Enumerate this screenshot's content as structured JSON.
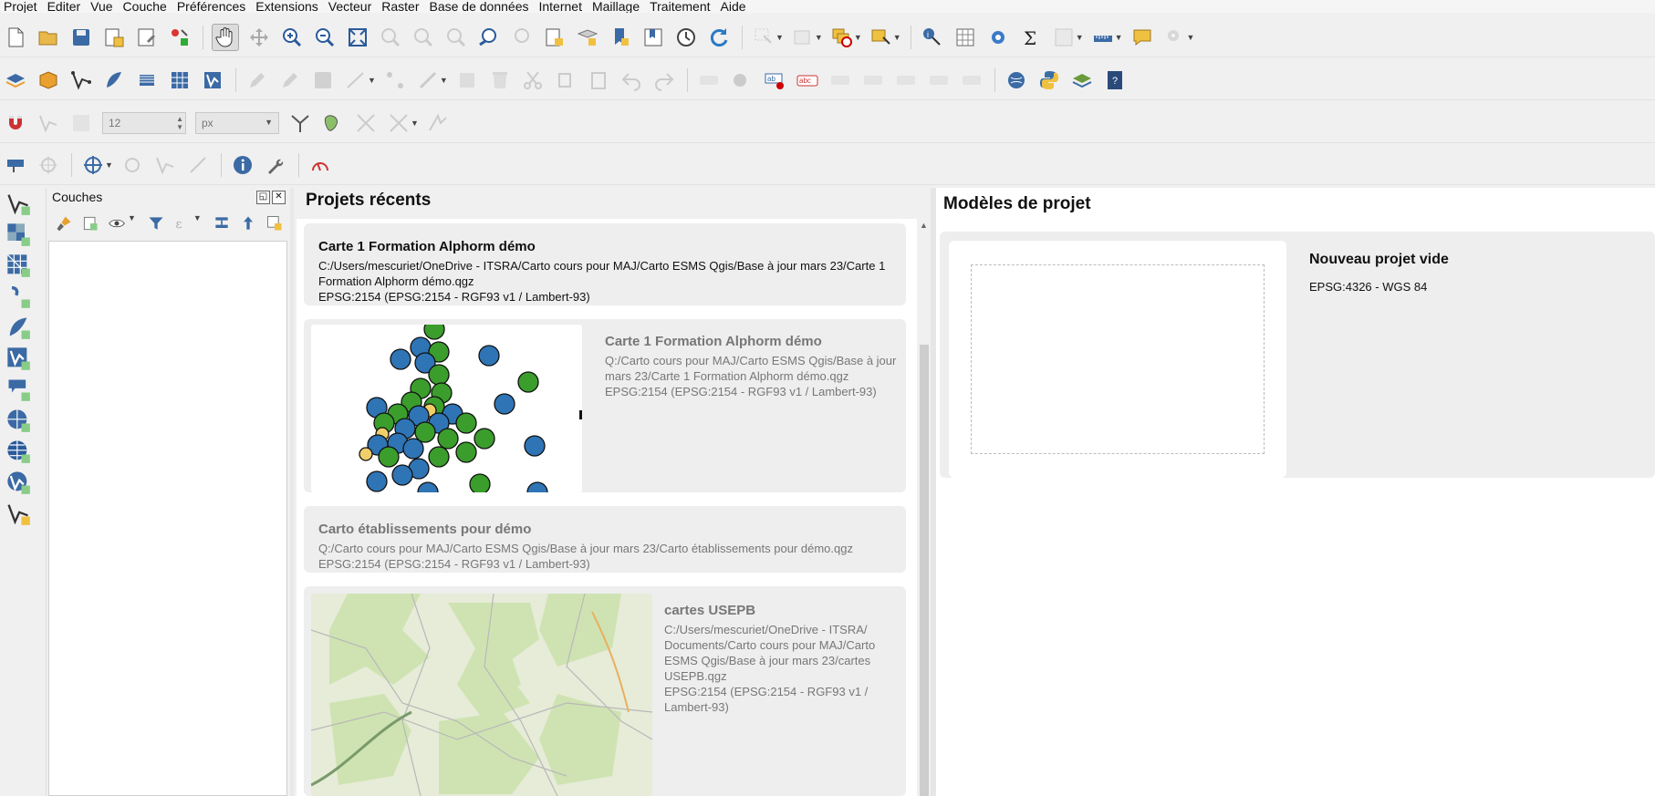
{
  "menu": [
    "Projet",
    "Editer",
    "Vue",
    "Couche",
    "Préférences",
    "Extensions",
    "Vecteur",
    "Raster",
    "Base de données",
    "Internet",
    "Maillage",
    "Traitement",
    "Aide"
  ],
  "snapping": {
    "tolerance": "12",
    "unit": "px"
  },
  "layers_panel": {
    "title": "Couches"
  },
  "recent": {
    "title": "Projets récents",
    "items": [
      {
        "name": "Carte 1 Formation Alphorm démo",
        "path_l1": "C:/Users/mescuriet/OneDrive - ITSRA/Carto cours pour MAJ/Carto ESMS Qgis/Base à jour mars 23/Carte 1",
        "path_l2": "Formation Alphorm démo.qgz",
        "crs": "EPSG:2154 (EPSG:2154 - RGF93 v1 / Lambert-93)"
      },
      {
        "name": "Carte 1 Formation Alphorm démo",
        "path_l1": "Q:/Carto cours pour MAJ/Carto ESMS Qgis/Base à jour",
        "path_l2": "mars 23/Carte 1 Formation Alphorm démo.qgz",
        "crs": "EPSG:2154 (EPSG:2154 - RGF93 v1 / Lambert-93)"
      },
      {
        "name": "Carto établissements pour démo",
        "path_l1": "Q:/Carto cours pour MAJ/Carto ESMS Qgis/Base à jour mars 23/Carto établissements pour démo.qgz",
        "crs": "EPSG:2154 (EPSG:2154 - RGF93 v1 / Lambert-93)"
      },
      {
        "name": "cartes USEPB",
        "path_l1": "C:/Users/mescuriet/OneDrive - ITSRA/",
        "path_l2": "Documents/Carto cours pour MAJ/Carto",
        "path_l3": "ESMS Qgis/Base à jour mars 23/cartes",
        "path_l4": "USEPB.qgz",
        "crs_l1": "EPSG:2154 (EPSG:2154 - RGF93 v1 /",
        "crs_l2": "Lambert-93)"
      }
    ]
  },
  "templates": {
    "title": "Modèles de projet",
    "items": [
      {
        "name": "Nouveau projet vide",
        "crs": "EPSG:4326 - WGS 84"
      }
    ]
  },
  "colors": {
    "point_blue": "#2f74b5",
    "point_green": "#3a9d2c",
    "point_yellow": "#f0cf6b",
    "map_green": "#cfe3b2"
  }
}
